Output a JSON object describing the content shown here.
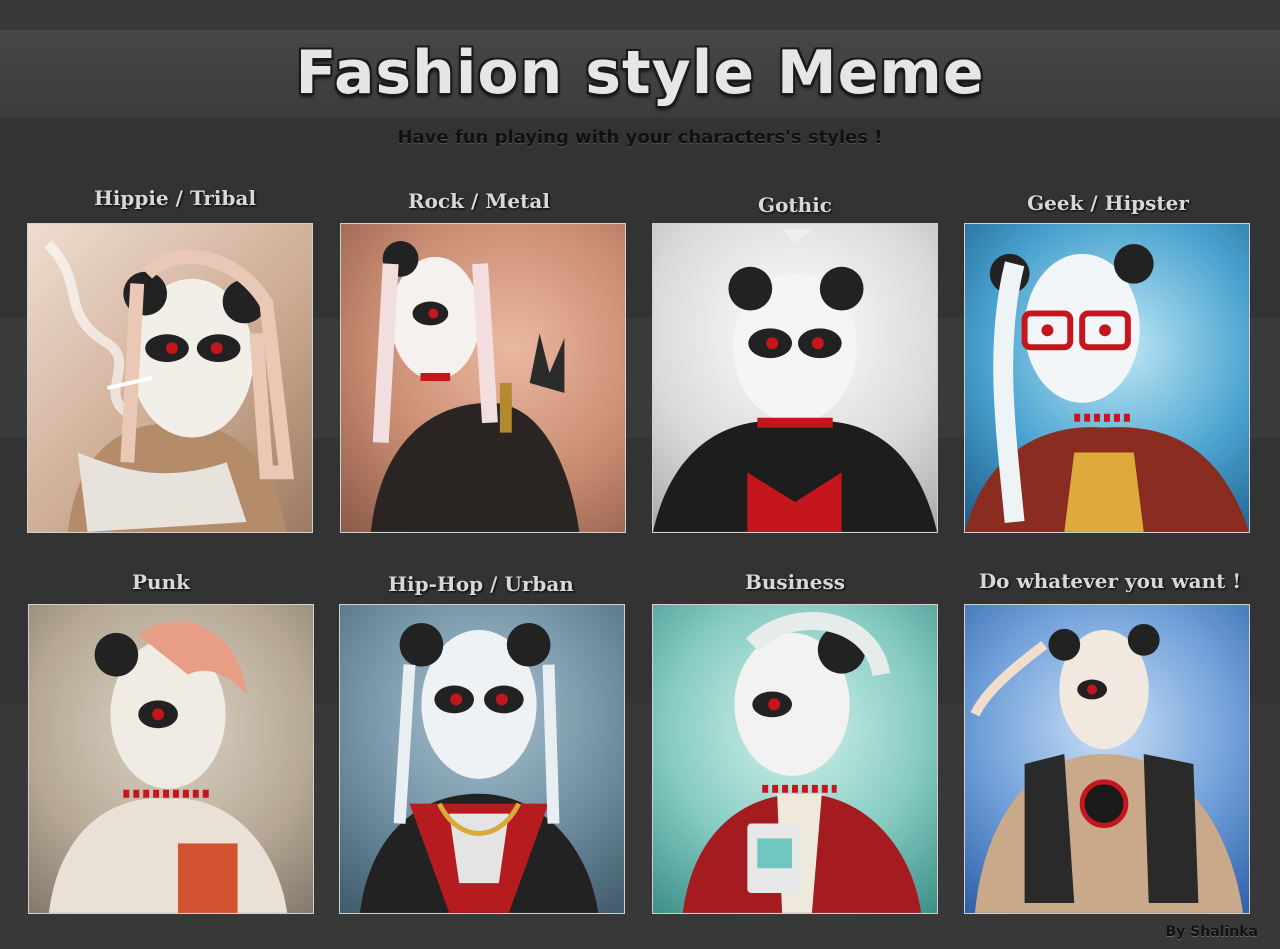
{
  "title": "Fashion style Meme",
  "subtitle": "Have fun playing with your characters's styles !",
  "credit": "By Shalinka",
  "panels": [
    {
      "label": "Hippie / Tribal"
    },
    {
      "label": "Rock / Metal"
    },
    {
      "label": "Gothic"
    },
    {
      "label": "Geek  / Hipster"
    },
    {
      "label": "Punk"
    },
    {
      "label": "Hip-Hop / Urban"
    },
    {
      "label": "Business"
    },
    {
      "label": "Do whatever you want !"
    }
  ],
  "colors": {
    "background": "#2f2f2f",
    "title_text": "#e6e6e6",
    "label_text": "#d8d8d8",
    "accent_red": "#c4161c"
  }
}
